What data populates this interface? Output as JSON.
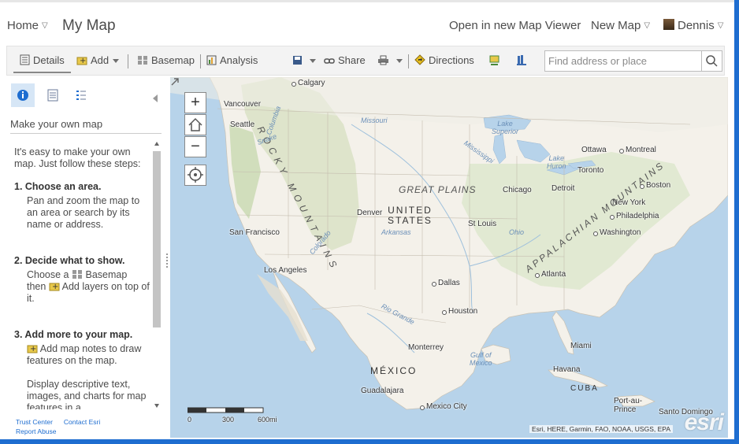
{
  "header": {
    "home_label": "Home",
    "title": "My Map",
    "open_viewer_label": "Open in new Map Viewer",
    "new_map_label": "New Map",
    "user_name": "Dennis"
  },
  "toolbar": {
    "details_label": "Details",
    "add_label": "Add",
    "basemap_label": "Basemap",
    "analysis_label": "Analysis",
    "share_label": "Share",
    "directions_label": "Directions",
    "search_placeholder": "Find address or place"
  },
  "panel": {
    "heading": "Make your own map",
    "intro": "It's easy to make your own map. Just follow these steps:",
    "steps": [
      {
        "title": "1. Choose an area.",
        "text": "Pan and zoom the map to an area or search by its name or address."
      },
      {
        "title": "2. Decide what to show.",
        "text_a": "Choose a",
        "basemap_word": "Basemap",
        "text_b": "then",
        "add_text": "Add layers on top of it."
      },
      {
        "title": "3. Add more to your map.",
        "text": "Add map notes to draw features on the map.",
        "text2": "Display descriptive text, images, and charts for map features in a"
      }
    ],
    "footer_links": [
      "Trust Center",
      "Contact Esri",
      "Report Abuse"
    ]
  },
  "map": {
    "cities": {
      "calgary": "Calgary",
      "vancouver": "Vancouver",
      "seattle": "Seattle",
      "san_francisco": "San Francisco",
      "los_angeles": "Los Angeles",
      "denver": "Denver",
      "dallas": "Dallas",
      "houston": "Houston",
      "st_louis": "St Louis",
      "chicago": "Chicago",
      "detroit": "Detroit",
      "toronto": "Toronto",
      "ottawa": "Ottawa",
      "montreal": "Montreal",
      "boston": "Boston",
      "new_york": "New York",
      "philadelphia": "Philadelphia",
      "washington": "Washington",
      "atlanta": "Atlanta",
      "miami": "Miami",
      "havana": "Havana",
      "monterrey": "Monterrey",
      "guadalajara": "Guadalajara",
      "mexico_city": "Mexico City",
      "port_au_prince": "Port-au-Prince",
      "santo_domingo": "Santo Domingo"
    },
    "regions": {
      "great_plains": "GREAT PLAINS",
      "rocky": "ROCKY MOUNTAINS",
      "appalachian": "APPALACHIAN MOUNTAINS"
    },
    "countries": {
      "usa_1": "UNITED",
      "usa_2": "STATES",
      "mexico": "MÉXICO",
      "cuba": "CUBA"
    },
    "water": {
      "missouri": "Missouri",
      "lake_superior_1": "Lake",
      "lake_superior_2": "Superior",
      "lake_huron_1": "Lake",
      "lake_huron_2": "Huron",
      "mississippi": "Mississippi",
      "snake": "Snake",
      "columbia": "Columbia",
      "colorado": "Colorado",
      "arkansas": "Arkansas",
      "ohio": "Ohio",
      "rio_grande": "Rio Grande",
      "gulf_1": "Gulf of",
      "gulf_2": "Mexico"
    },
    "scale_labels": [
      "0",
      "300",
      "600mi"
    ],
    "attribution": "Esri, HERE, Garmin, FAO, NOAA, USGS, EPA",
    "logo": "esri"
  }
}
